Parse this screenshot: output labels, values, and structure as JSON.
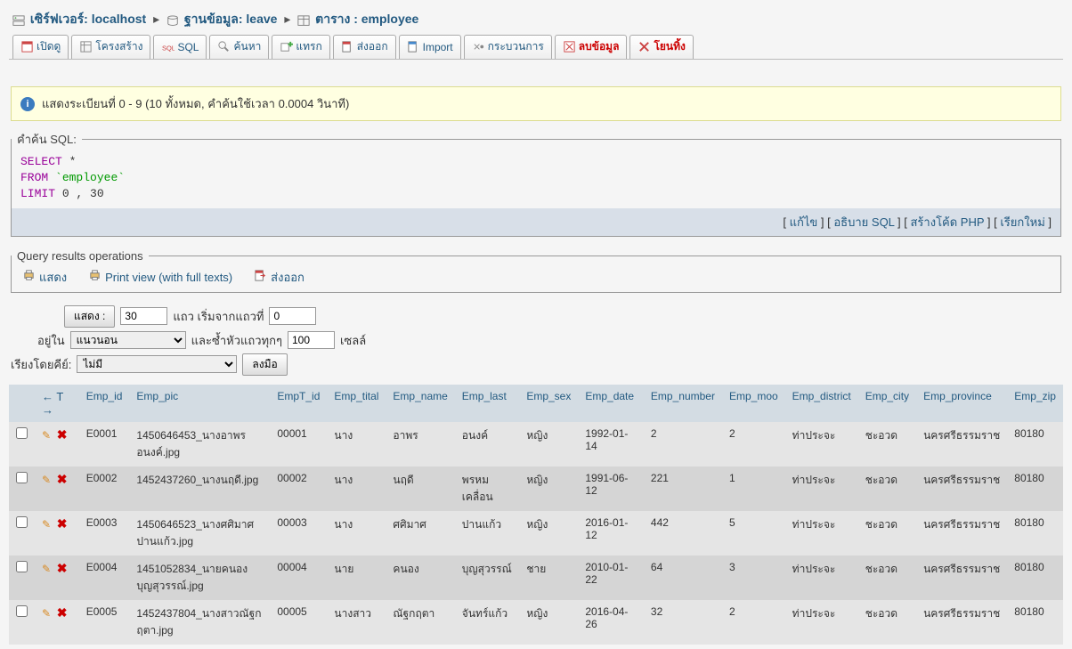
{
  "breadcrumb": {
    "server_label": "เซิร์ฟเวอร์: localhost",
    "db_label": "ฐานข้อมูล: leave",
    "table_label": "ตาราง : employee"
  },
  "tabs": [
    {
      "label": "เปิดดู",
      "icon": "browse"
    },
    {
      "label": "โครงสร้าง",
      "icon": "structure"
    },
    {
      "label": "SQL",
      "icon": "sql"
    },
    {
      "label": "ค้นหา",
      "icon": "search"
    },
    {
      "label": "แทรก",
      "icon": "insert"
    },
    {
      "label": "ส่งออก",
      "icon": "export"
    },
    {
      "label": "Import",
      "icon": "import"
    },
    {
      "label": "กระบวนการ",
      "icon": "operations"
    },
    {
      "label": "ลบข้อมูล",
      "icon": "empty",
      "red": true
    },
    {
      "label": "โยนทิ้ง",
      "icon": "drop",
      "red": true
    }
  ],
  "notice": "แสดงระเบียนที่ 0 - 9 (10 ทั้งหมด, คำค้นใช้เวลา 0.0004 วินาที)",
  "sql_section": {
    "legend": "คำค้น SQL:",
    "kw_select": "SELECT",
    "star": "*",
    "kw_from": "FROM",
    "table": "`employee`",
    "kw_limit": "LIMIT",
    "limit_vals": "0 , 30",
    "actions": {
      "edit": "แก้ไข",
      "explain": "อธิบาย SQL",
      "php": "สร้างโค้ด PHP",
      "refresh": "เรียกใหม่"
    }
  },
  "ops": {
    "legend": "Query results operations",
    "show": "แสดง",
    "print": "Print view (with full texts)",
    "export": "ส่งออก"
  },
  "controls": {
    "show_btn": "แสดง :",
    "show_val": "30",
    "start_label": "แถว เริ่มจากแถวที่",
    "start_val": "0",
    "in_label": "อยู่ใน",
    "mode": "แนวนอน",
    "repeat_label": "และซ้ำหัวแถวทุกๆ",
    "repeat_val": "100",
    "cell_label": "เซลล์",
    "sort_label": "เรียงโดยคีย์:",
    "sort_val": "ไม่มี",
    "go_btn": "ลงมือ"
  },
  "columns": [
    "Emp_id",
    "Emp_pic",
    "EmpT_id",
    "Emp_tital",
    "Emp_name",
    "Emp_last",
    "Emp_sex",
    "Emp_date",
    "Emp_number",
    "Emp_moo",
    "Emp_district",
    "Emp_city",
    "Emp_province",
    "Emp_zip"
  ],
  "rows": [
    {
      "Emp_id": "E0001",
      "Emp_pic": "1450646453_นางอาพร อนงค์.jpg",
      "EmpT_id": "00001",
      "Emp_tital": "นาง",
      "Emp_name": "อาพร",
      "Emp_last": "อนงค์",
      "Emp_sex": "หญิง",
      "Emp_date": "1992-01-14",
      "Emp_number": "2",
      "Emp_moo": "2",
      "Emp_district": "ท่าประจะ",
      "Emp_city": "ชะอวด",
      "Emp_province": "นครศรีธรรมราช",
      "Emp_zip": "80180"
    },
    {
      "Emp_id": "E0002",
      "Emp_pic": "1452437260_นางนฤดี.jpg",
      "EmpT_id": "00002",
      "Emp_tital": "นาง",
      "Emp_name": "นฤดี",
      "Emp_last": "พรหมเคลื่อน",
      "Emp_sex": "หญิง",
      "Emp_date": "1991-06-12",
      "Emp_number": "221",
      "Emp_moo": "1",
      "Emp_district": "ท่าประจะ",
      "Emp_city": "ชะอวด",
      "Emp_province": "นครศรีธรรมราช",
      "Emp_zip": "80180"
    },
    {
      "Emp_id": "E0003",
      "Emp_pic": "1450646523_นางศศิมาศ ปานแก้ว.jpg",
      "EmpT_id": "00003",
      "Emp_tital": "นาง",
      "Emp_name": "ศศิมาศ",
      "Emp_last": "ปานแก้ว",
      "Emp_sex": "หญิง",
      "Emp_date": "2016-01-12",
      "Emp_number": "442",
      "Emp_moo": "5",
      "Emp_district": "ท่าประจะ",
      "Emp_city": "ชะอวด",
      "Emp_province": "นครศรีธรรมราช",
      "Emp_zip": "80180"
    },
    {
      "Emp_id": "E0004",
      "Emp_pic": "1451052834_นายคนอง บุญสุวรรณ์.jpg",
      "EmpT_id": "00004",
      "Emp_tital": "นาย",
      "Emp_name": "คนอง",
      "Emp_last": "บุญสุวรรณ์",
      "Emp_sex": "ชาย",
      "Emp_date": "2010-01-22",
      "Emp_number": "64",
      "Emp_moo": "3",
      "Emp_district": "ท่าประจะ",
      "Emp_city": "ชะอวด",
      "Emp_province": "นครศรีธรรมราช",
      "Emp_zip": "80180"
    },
    {
      "Emp_id": "E0005",
      "Emp_pic": "1452437804_นางสาวณัฐกฤตา.jpg",
      "EmpT_id": "00005",
      "Emp_tital": "นางสาว",
      "Emp_name": "ณัฐกฤตา",
      "Emp_last": "จันทร์แก้ว",
      "Emp_sex": "หญิง",
      "Emp_date": "2016-04-26",
      "Emp_number": "32",
      "Emp_moo": "2",
      "Emp_district": "ท่าประจะ",
      "Emp_city": "ชะอวด",
      "Emp_province": "นครศรีธรรมราช",
      "Emp_zip": "80180"
    }
  ]
}
